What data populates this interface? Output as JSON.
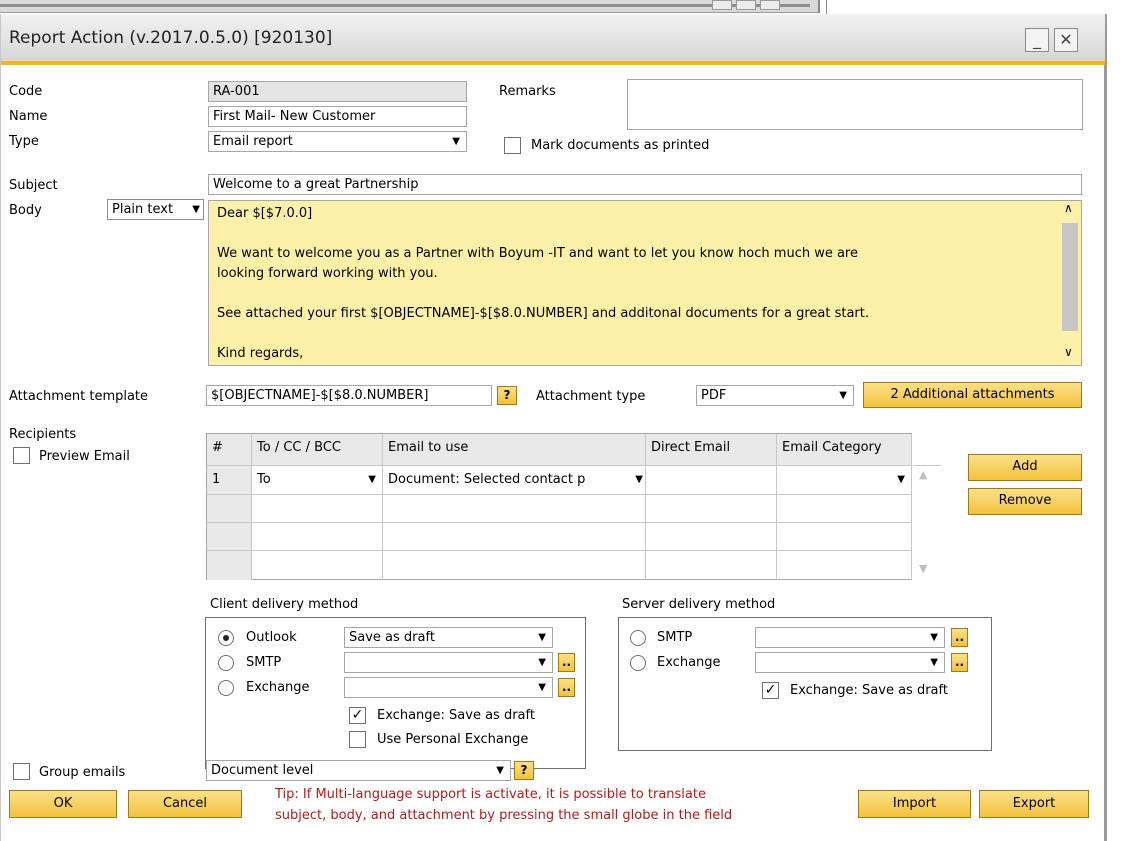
{
  "window": {
    "title": "Report Action (v.2017.0.5.0) [920130]",
    "minimize_icon": "minimize-icon",
    "close_icon": "close-icon",
    "minimize_glyph": "_",
    "close_glyph": "✕"
  },
  "header": {
    "code_label": "Code",
    "code_value": "RA-001",
    "name_label": "Name",
    "name_value": "First Mail- New Customer",
    "type_label": "Type",
    "type_value": "Email report",
    "remarks_label": "Remarks",
    "remarks_value": "",
    "mark_printed_label": "Mark documents as printed",
    "mark_printed_checked": false
  },
  "email": {
    "subject_label": "Subject",
    "subject_value": "Welcome to a great Partnership",
    "body_label": "Body",
    "body_format": "Plain text",
    "body_text": "Dear $[$7.0.0]\n\nWe want to welcome you as a Partner with Boyum -IT and want to let you know hoch much we are\nlooking forward working with you.\n\nSee attached your first $[OBJECTNAME]-$[$8.0.NUMBER] and additonal documents for a great start.\n\nKind regards,"
  },
  "attachment": {
    "template_label": "Attachment template",
    "template_value": "$[OBJECTNAME]-$[$8.0.NUMBER]",
    "help_glyph": "?",
    "type_label": "Attachment type",
    "type_value": "PDF",
    "additional_button": "2 Additional attachments"
  },
  "recipients": {
    "label": "Recipients",
    "preview_label": "Preview Email",
    "preview_checked": false,
    "columns": [
      "#",
      "To / CC / BCC",
      "Email to use",
      "Direct Email",
      "Email Category"
    ],
    "rows": [
      [
        "1",
        "To",
        "Document: Selected contact p",
        "",
        ""
      ],
      [
        "",
        "",
        "",
        "",
        ""
      ],
      [
        "",
        "",
        "",
        "",
        ""
      ],
      [
        "",
        "",
        "",
        "",
        ""
      ]
    ],
    "add_button": "Add",
    "remove_button": "Remove"
  },
  "client_delivery": {
    "title": "Client delivery method",
    "options": [
      "Outlook",
      "SMTP",
      "Exchange"
    ],
    "selected": "Outlook",
    "outlook_value": "Save as draft",
    "exchange_draft_label": "Exchange: Save as draft",
    "exchange_draft_checked": true,
    "personal_exchange_label": "Use Personal Exchange",
    "personal_exchange_checked": false,
    "browse_glyph": ".."
  },
  "server_delivery": {
    "title": "Server delivery method",
    "options": [
      "SMTP",
      "Exchange"
    ],
    "exchange_draft_label": "Exchange: Save as draft",
    "exchange_draft_checked": true,
    "browse_glyph": ".."
  },
  "grouping": {
    "group_emails_label": "Group emails",
    "group_emails_checked": false,
    "level_value": "Document level"
  },
  "footer": {
    "ok_button": "OK",
    "cancel_button": "Cancel",
    "tip_line1": "Tip: If Multi-language support is activate, it is possible to translate",
    "tip_line2": "subject, body, and attachment by pressing the small globe in the field",
    "import_button": "Import",
    "export_button": "Export"
  },
  "glyphs": {
    "dropdown": "▼",
    "check": "✓",
    "scroll_up": "∧",
    "scroll_down": "∨",
    "grid_scroll_up": "▲",
    "grid_scroll_down": "▼"
  },
  "colors": {
    "accent": "#f5b70f",
    "body_background": "#fdf0a8",
    "tip_text": "#b01c1c",
    "button_yellow": "#f3c23c"
  }
}
